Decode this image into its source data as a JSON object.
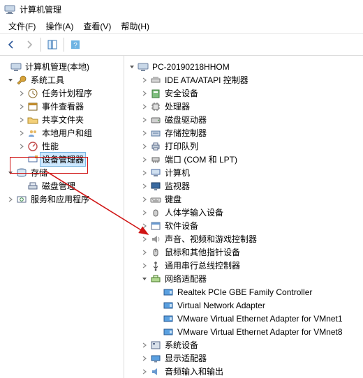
{
  "app": {
    "title": "计算机管理"
  },
  "menubar": {
    "file": "文件(F)",
    "action": "操作(A)",
    "view": "查看(V)",
    "help": "帮助(H)"
  },
  "left_tree": {
    "root": "计算机管理(本地)",
    "system_tools": {
      "label": "系统工具",
      "task_scheduler": "任务计划程序",
      "event_viewer": "事件查看器",
      "shared_folders": "共享文件夹",
      "local_users": "本地用户和组",
      "performance": "性能",
      "device_manager": "设备管理器"
    },
    "storage": {
      "label": "存储",
      "disk_mgmt": "磁盘管理"
    },
    "services_apps": "服务和应用程序"
  },
  "right_tree": {
    "computer": "PC-20190218HHOM",
    "ide_atapi": "IDE ATA/ATAPI 控制器",
    "security": "安全设备",
    "processors": "处理器",
    "disk_drives": "磁盘驱动器",
    "storage_ctl": "存储控制器",
    "print_queues": "打印队列",
    "ports": "端口 (COM 和 LPT)",
    "computers": "计算机",
    "monitors": "监视器",
    "keyboards": "键盘",
    "hid": "人体学输入设备",
    "software_dev": "软件设备",
    "sound": "声音、视频和游戏控制器",
    "mice": "鼠标和其他指针设备",
    "usb": "通用串行总线控制器",
    "network": {
      "label": "网络适配器",
      "items": [
        "Realtek PCIe GBE Family Controller",
        "Virtual Network Adapter",
        "VMware Virtual Ethernet Adapter for VMnet1",
        "VMware Virtual Ethernet Adapter for VMnet8"
      ]
    },
    "system_dev": "系统设备",
    "display": "显示适配器",
    "audio_io": "音频输入和输出"
  }
}
